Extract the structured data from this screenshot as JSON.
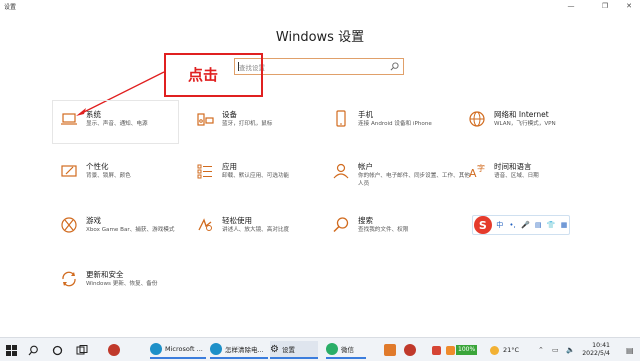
{
  "window": {
    "title": "设置",
    "min_glyph": "—",
    "max_glyph": "❐",
    "close_glyph": "✕"
  },
  "page_title": "Windows 设置",
  "search": {
    "placeholder": "查找设置"
  },
  "annotation": {
    "text": "点击",
    "color": "#e02020"
  },
  "accent": "#d16b1f",
  "categories": [
    {
      "name": "系统",
      "desc": "显示、声音、通知、电源",
      "icon": "laptop-icon"
    },
    {
      "name": "设备",
      "desc": "蓝牙，打印机，鼠标",
      "icon": "keyboard-speaker-icon"
    },
    {
      "name": "手机",
      "desc": "连接 Android 设备和 iPhone",
      "icon": "phone-icon"
    },
    {
      "name": "网络和 Internet",
      "desc": "WLAN，飞行模式，VPN",
      "icon": "globe-icon"
    },
    {
      "name": "个性化",
      "desc": "背景、锁屏、颜色",
      "icon": "paint-icon"
    },
    {
      "name": "应用",
      "desc": "卸载、默认应用、可选功能",
      "icon": "apps-list-icon"
    },
    {
      "name": "帐户",
      "desc": "你的帐户、电子邮件、同步设置、工作、其他人员",
      "icon": "person-icon"
    },
    {
      "name": "时间和语言",
      "desc": "语音、区域、日期",
      "icon": "time-language-icon"
    },
    {
      "name": "游戏",
      "desc": "Xbox Game Bar、捕获、游戏模式",
      "icon": "xbox-icon"
    },
    {
      "name": "轻松使用",
      "desc": "讲述人、放大镜、高对比度",
      "icon": "ease-of-access-icon"
    },
    {
      "name": "搜索",
      "desc": "查找我的文件、权限",
      "icon": "search-icon"
    },
    {
      "name": "更新和安全",
      "desc": "Windows 更新、恢复、备份",
      "icon": "update-icon"
    }
  ],
  "ime_toolbar": {
    "logo": "S",
    "items": [
      "中",
      "•,",
      "🎤",
      "▤",
      "👕",
      "▦"
    ]
  },
  "taskbar": {
    "edge_label": "Microsoft ...",
    "edge2_label": "怎样清除电...",
    "settings_label": "设置",
    "wechat_label": "微信",
    "battery": "100%",
    "temperature": "21°C",
    "time": "10:41",
    "date": "2022/5/4"
  }
}
